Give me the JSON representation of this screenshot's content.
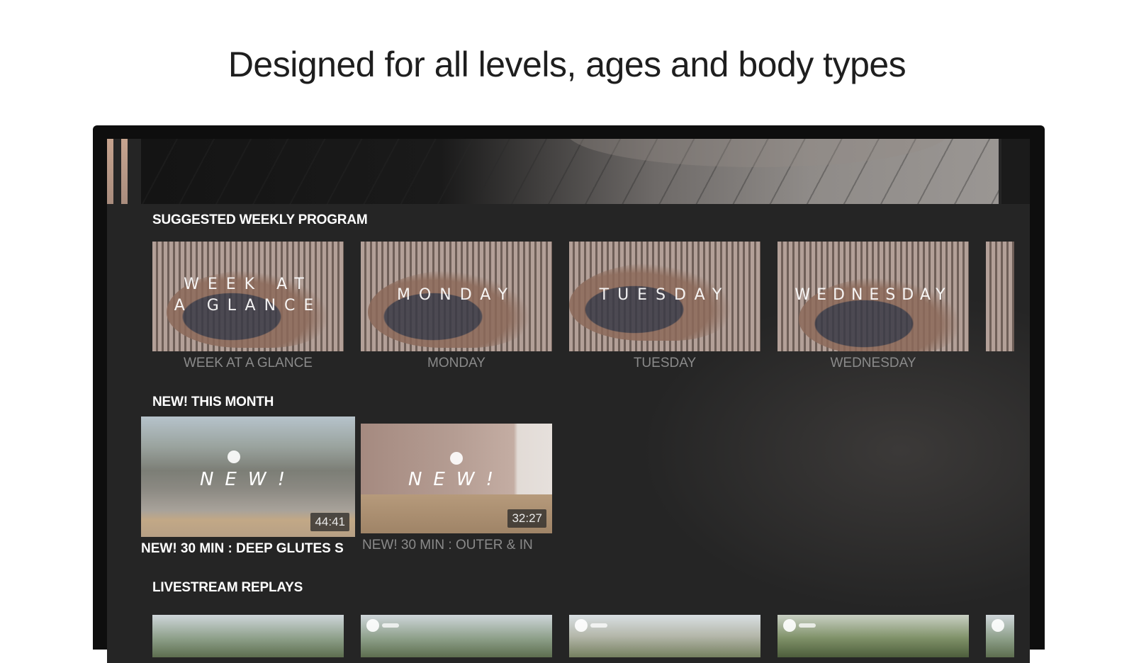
{
  "headline": "Designed for all levels, ages and body types",
  "sections": {
    "weekly": {
      "title": "SUGGESTED WEEKLY PROGRAM",
      "tiles": [
        {
          "overlay_line1": "WEEK AT",
          "overlay_line2": "A GLANCE",
          "caption": "WEEK AT A GLANCE"
        },
        {
          "overlay_line1": "MONDAY",
          "overlay_line2": "",
          "caption": "MONDAY"
        },
        {
          "overlay_line1": "TUESDAY",
          "overlay_line2": "",
          "caption": "TUESDAY"
        },
        {
          "overlay_line1": "WEDNESDAY",
          "overlay_line2": "",
          "caption": "WEDNESDAY"
        }
      ]
    },
    "new_month": {
      "title": "NEW! THIS MONTH",
      "videos": [
        {
          "overlay": "NEW!",
          "duration": "44:41",
          "caption": "NEW! 30 MIN : DEEP GLUTES S",
          "focused": true
        },
        {
          "overlay": "NEW!",
          "duration": "32:27",
          "caption": "NEW! 30 MIN : OUTER & IN",
          "focused": false
        }
      ]
    },
    "livestream": {
      "title": "LIVESTREAM REPLAYS"
    }
  },
  "colors": {
    "accent_stripe": "#c7a48f",
    "screen_bg": "#252525",
    "caption_muted": "#8a8a8a",
    "caption_focused": "#ffffff"
  }
}
